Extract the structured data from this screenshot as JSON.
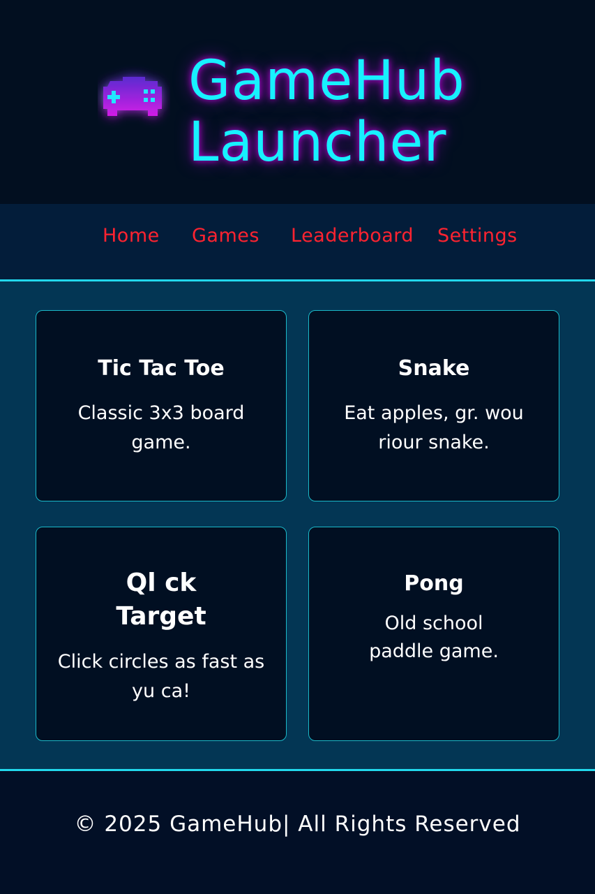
{
  "app": {
    "title_line1": "GameHub",
    "title_line2": "Launcher",
    "logo_icon": "gamepad-icon",
    "accent_color": "#17f1ff",
    "glow_color": "#e600ff"
  },
  "nav": {
    "items": [
      {
        "label": "Home"
      },
      {
        "label": "Games"
      },
      {
        "label": "Leaderboard"
      },
      {
        "label": "Settings"
      }
    ],
    "color": "#ff2330"
  },
  "games": [
    {
      "title": "Tic Tac Toe",
      "description": "Classic 3x3 board game."
    },
    {
      "title": "Snake",
      "description": "Eat apples, gr. wou riour snake."
    },
    {
      "title": "Ql ck Target",
      "description": "Click circles as fast as yu ca!"
    },
    {
      "title": "Pong",
      "description": "Old school paddle game."
    }
  ],
  "footer": {
    "text": "© 2025 GameHub| All Rights Reserved"
  }
}
